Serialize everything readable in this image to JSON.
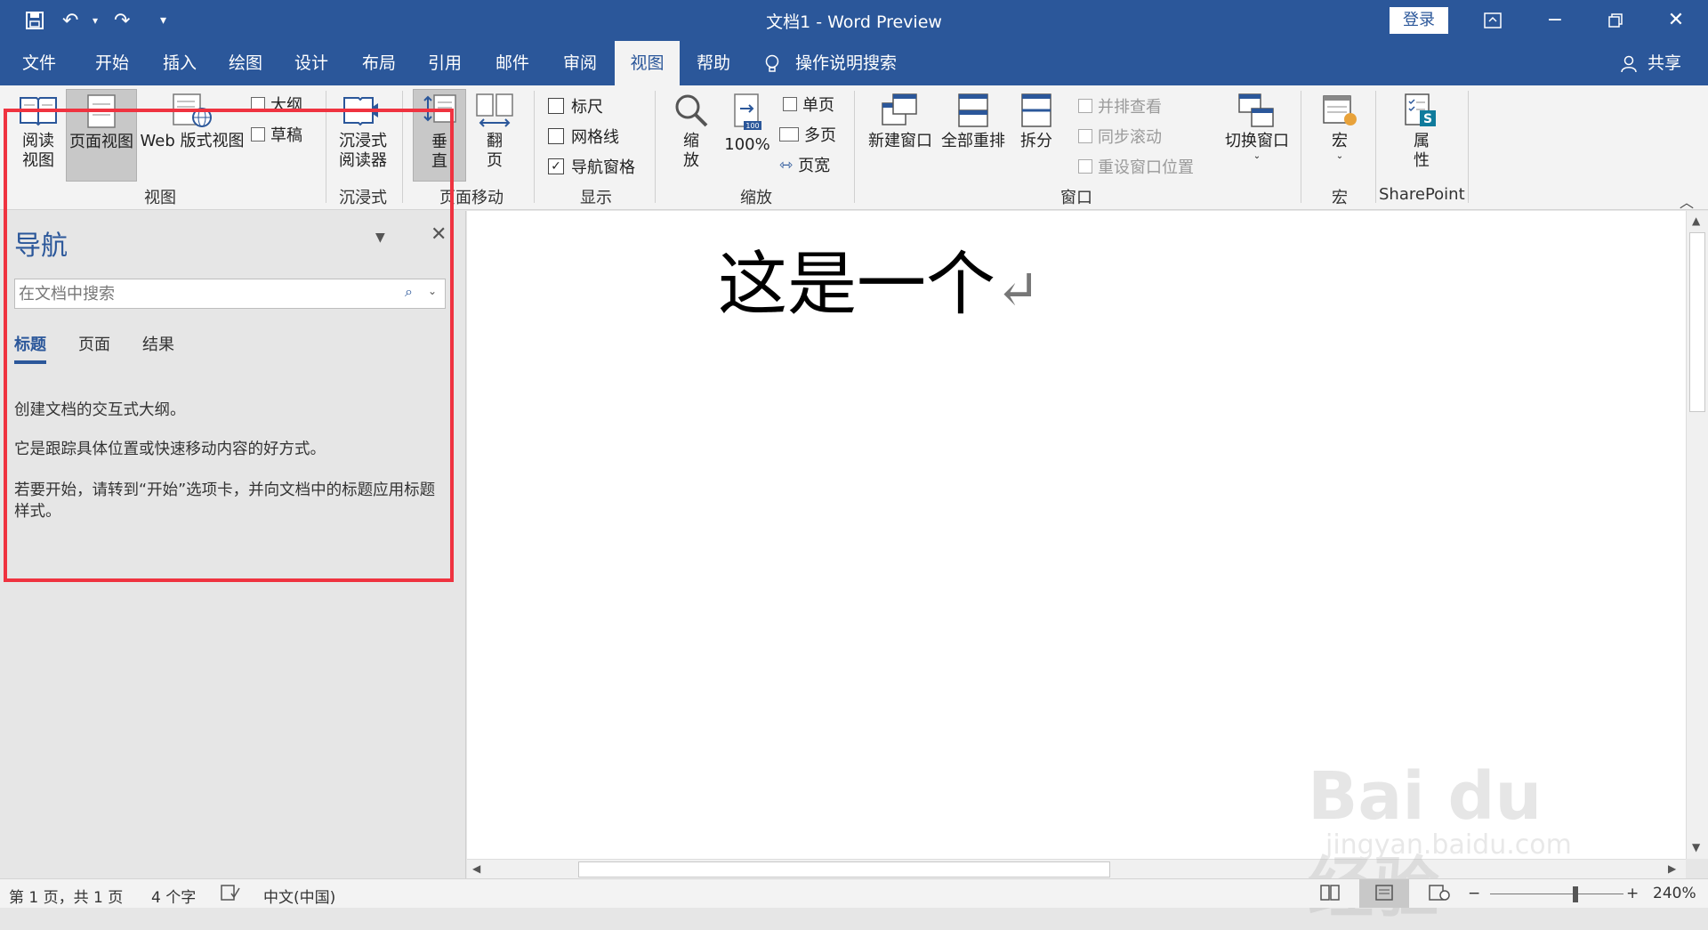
{
  "title_bar": {
    "title": "文档1  -  Word Preview",
    "login_label": "登录",
    "customize_symbol": "▾"
  },
  "menu": {
    "tabs": [
      "文件",
      "开始",
      "插入",
      "绘图",
      "设计",
      "布局",
      "引用",
      "邮件",
      "审阅",
      "视图",
      "帮助"
    ],
    "active_tab": "视图",
    "tell_me": "操作说明搜索",
    "share": "共享"
  },
  "ribbon": {
    "views": {
      "read_mode": "阅读\n视图",
      "print_layout": "页面视图",
      "web_layout": "Web 版式视图",
      "outline": "大纲",
      "draft": "草稿",
      "group": "视图"
    },
    "immersive": {
      "reader": "沉浸式\n阅读器",
      "group": "沉浸式"
    },
    "page_movement": {
      "vertical": "垂\n直",
      "side_to_side": "翻\n页",
      "group": "页面移动"
    },
    "show": {
      "ruler": "标尺",
      "gridlines": "网格线",
      "nav_pane": "导航窗格",
      "ruler_checked": false,
      "gridlines_checked": false,
      "nav_pane_checked": true,
      "group": "显示"
    },
    "zoom": {
      "zoom": "缩\n放",
      "hundred": "100%",
      "one_page": "单页",
      "multiple_pages": "多页",
      "page_width": "页宽",
      "group": "缩放"
    },
    "window": {
      "new_window": "新建窗口",
      "arrange_all": "全部重排",
      "split": "拆分",
      "side_by_side": "并排查看",
      "sync_scroll": "同步滚动",
      "reset_position": "重设窗口位置",
      "switch_windows": "切换窗口",
      "group": "窗口"
    },
    "macros": {
      "macros": "宏",
      "group": "宏"
    },
    "sharepoint": {
      "properties": "属\n性",
      "group": "SharePoint"
    }
  },
  "nav_pane": {
    "title": "导航",
    "search_placeholder": "在文档中搜索",
    "tabs": [
      "标题",
      "页面",
      "结果"
    ],
    "active_tab": "标题",
    "text1": "创建文档的交互式大纲。",
    "text2": "它是跟踪具体位置或快速移动内容的好方式。",
    "text3": "若要开始，请转到“开始”选项卡，并向文档中的标题应用标题样式。"
  },
  "document": {
    "content": "这是一个",
    "paragraph_mark": "↵"
  },
  "status_bar": {
    "page": "第 1 页，共 1 页",
    "words": "4 个字",
    "language": "中文(中国)",
    "zoom_minus": "−",
    "zoom_plus": "+",
    "zoom_level": "240%"
  },
  "watermark": {
    "brand": "Bai du 经验",
    "url": "jingyan.baidu.com"
  },
  "colors": {
    "accent": "#2b579a",
    "highlight_box": "#ef3340"
  }
}
